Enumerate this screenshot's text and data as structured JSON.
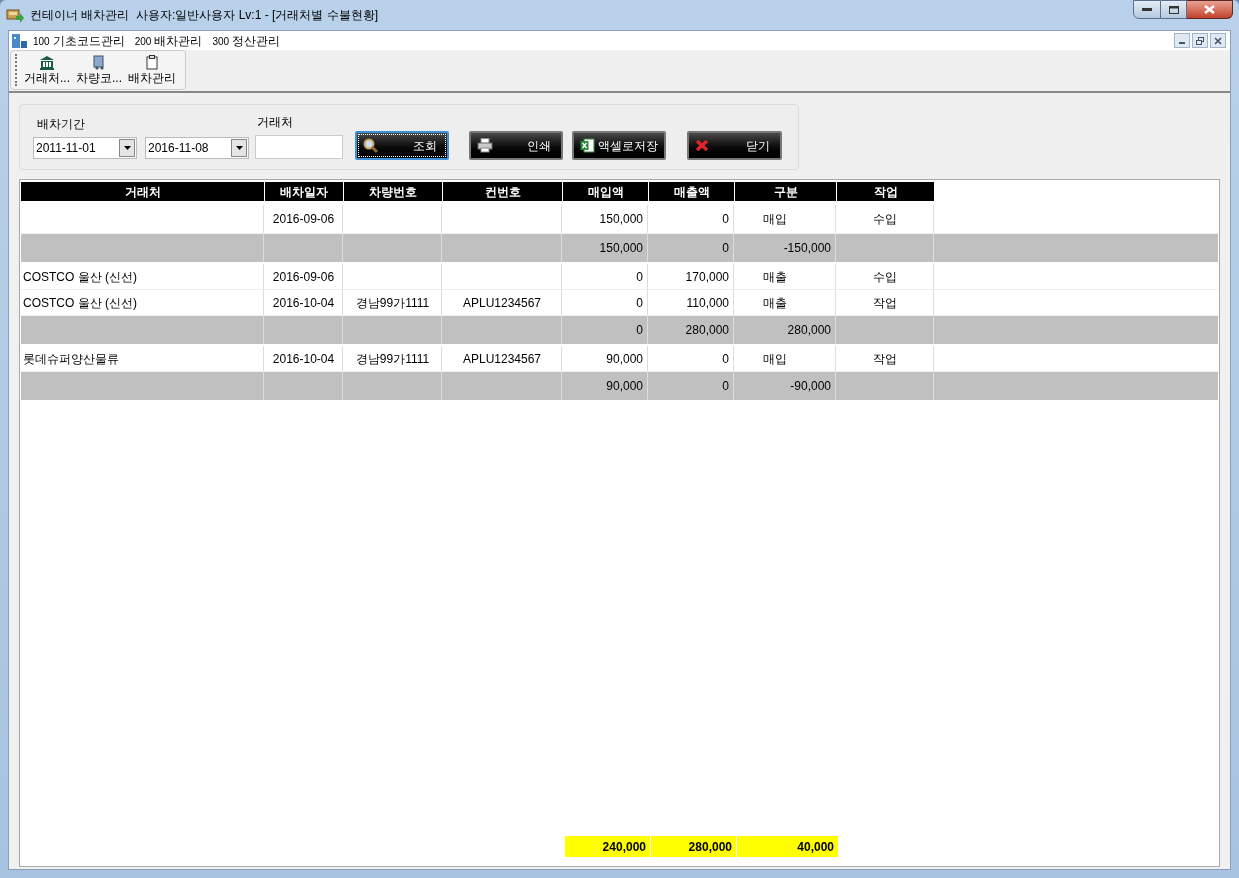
{
  "window": {
    "title": "컨테이너 배차관리  사용자:일반사용자 Lv:1 - [거래처별 수불현황]"
  },
  "menu": [
    {
      "code": "100",
      "label": "기초코드관리"
    },
    {
      "code": "200",
      "label": "배차관리"
    },
    {
      "code": "300",
      "label": "정산관리"
    }
  ],
  "toolbar": [
    {
      "kind": "bank",
      "label": "거래처..."
    },
    {
      "kind": "truck",
      "label": "차량코..."
    },
    {
      "kind": "clipboard",
      "label": "배차관리"
    }
  ],
  "filter": {
    "period_label": "배차기간",
    "date_from": "2011-11-01",
    "date_to": "2016-11-08",
    "client_label": "거래처"
  },
  "buttons": [
    {
      "kind": "search",
      "label": "조회",
      "focused": true
    },
    {
      "kind": "print",
      "label": "인쇄",
      "focused": false
    },
    {
      "kind": "excel",
      "label": "액셀로저장",
      "focused": false
    },
    {
      "kind": "close",
      "label": "닫기",
      "focused": false
    }
  ],
  "table": {
    "columns": [
      "거래처",
      "배차일자",
      "차량번호",
      "컨번호",
      "매입액",
      "매출액",
      "구분",
      "작업"
    ],
    "rows": [
      {
        "kind": "detail",
        "cells": [
          "",
          "2016-09-06",
          "",
          "",
          "150,000",
          "0",
          "매입",
          "수입"
        ]
      },
      {
        "kind": "subtotal",
        "cells": [
          "",
          "",
          "",
          "",
          "150,000",
          "0",
          "-150,000",
          ""
        ]
      },
      {
        "kind": "detail",
        "cells": [
          "COSTCO 울산 (신선)",
          "2016-09-06",
          "",
          "",
          "0",
          "170,000",
          "매출",
          "수입"
        ]
      },
      {
        "kind": "detail",
        "cells": [
          "COSTCO 울산 (신선)",
          "2016-10-04",
          "경남99가1111",
          "APLU1234567",
          "0",
          "110,000",
          "매출",
          "작업"
        ]
      },
      {
        "kind": "subtotal",
        "cells": [
          "",
          "",
          "",
          "",
          "0",
          "280,000",
          "280,000",
          ""
        ]
      },
      {
        "kind": "detail",
        "cells": [
          "롯데슈퍼양산물류",
          "2016-10-04",
          "경남99가1111",
          "APLU1234567",
          "90,000",
          "0",
          "매입",
          "작업"
        ]
      },
      {
        "kind": "subtotal",
        "cells": [
          "",
          "",
          "",
          "",
          "90,000",
          "0",
          "-90,000",
          ""
        ]
      }
    ],
    "totals": [
      "240,000",
      "280,000",
      "40,000"
    ]
  }
}
